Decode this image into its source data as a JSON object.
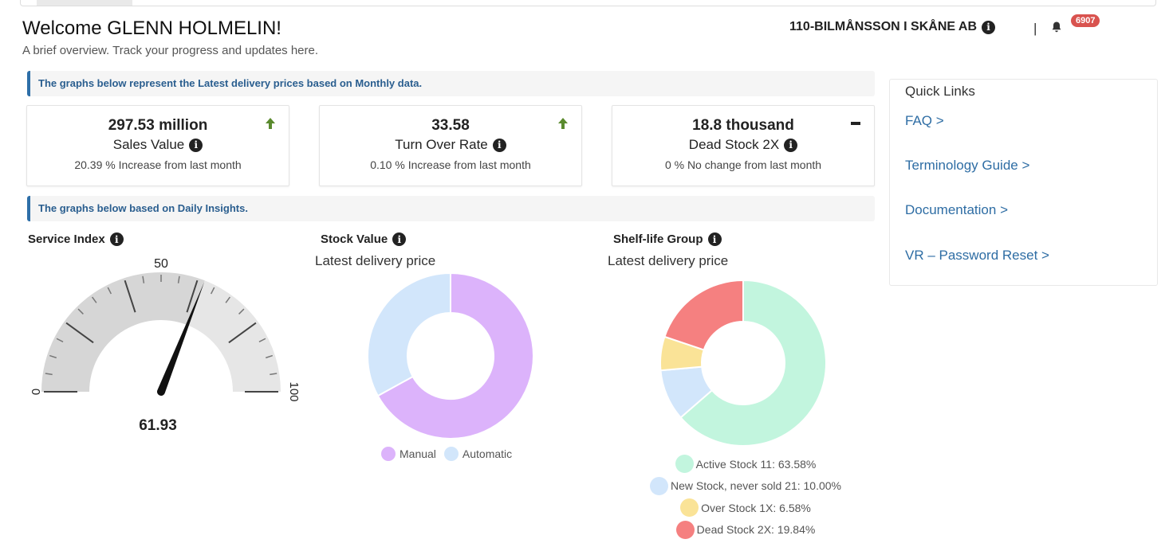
{
  "header": {
    "welcome": "Welcome GLENN HOLMELIN!",
    "subtitle": "A brief overview. Track your progress and updates here.",
    "company": "110-BILMÅNSSON I SKÅNE AB",
    "separator": "|",
    "notification_count": "6907"
  },
  "banners": {
    "monthly": "The graphs below represent the Latest delivery prices based on Monthly data.",
    "daily": "The graphs below based on Daily Insights."
  },
  "kpis": [
    {
      "value": "297.53 million",
      "label": "Sales Value",
      "change": "20.39 % Increase from last month",
      "trend": "up"
    },
    {
      "value": "33.58",
      "label": "Turn Over Rate",
      "change": "0.10 % Increase from last month",
      "trend": "up"
    },
    {
      "value": "18.8 thousand",
      "label": "Dead Stock 2X",
      "change": "0 % No change from last month",
      "trend": "flat"
    }
  ],
  "service_index": {
    "title": "Service Index",
    "value_label": "61.93",
    "tick_min": "0",
    "tick_mid": "50",
    "tick_max": "100"
  },
  "stock_value": {
    "title": "Stock Value",
    "subtitle": "Latest delivery price",
    "legend_manual": "Manual",
    "legend_automatic": "Automatic"
  },
  "shelf_life": {
    "title": "Shelf-life Group",
    "subtitle": "Latest delivery price",
    "legend": [
      "Active Stock 11: 63.58%",
      "New Stock, never sold 21: 10.00%",
      "Over Stock 1X: 6.58%",
      "Dead Stock 2X: 19.84%"
    ]
  },
  "quick_links": {
    "title": "Quick Links",
    "items": [
      "FAQ >",
      "Terminology Guide >",
      "Documentation >",
      "VR – Password Reset >"
    ]
  },
  "colors": {
    "accent": "#2e6fa8",
    "badge": "#d9534f",
    "trend_up": "#5a8a2e",
    "manual": "#dcb3fb",
    "automatic": "#d2e6fb",
    "active": "#c2f5de",
    "new": "#d2e6fb",
    "over": "#fae397",
    "dead": "#f58080"
  },
  "chart_data": [
    {
      "type": "gauge",
      "title": "Service Index",
      "value": 61.93,
      "range": [
        0,
        100
      ],
      "tick_labels": [
        "0",
        "50",
        "100"
      ]
    },
    {
      "type": "pie",
      "title": "Stock Value",
      "subtitle": "Latest delivery price",
      "categories": [
        "Manual",
        "Automatic"
      ],
      "values": [
        67,
        33
      ],
      "colors": [
        "#dcb3fb",
        "#d2e6fb"
      ],
      "legend": "bottom"
    },
    {
      "type": "pie",
      "title": "Shelf-life Group",
      "subtitle": "Latest delivery price",
      "categories": [
        "Active Stock 11",
        "New Stock, never sold 21",
        "Over Stock 1X",
        "Dead Stock 2X"
      ],
      "values": [
        63.58,
        10.0,
        6.58,
        19.84
      ],
      "colors": [
        "#c2f5de",
        "#d2e6fb",
        "#fae397",
        "#f58080"
      ],
      "legend": "bottom"
    }
  ]
}
